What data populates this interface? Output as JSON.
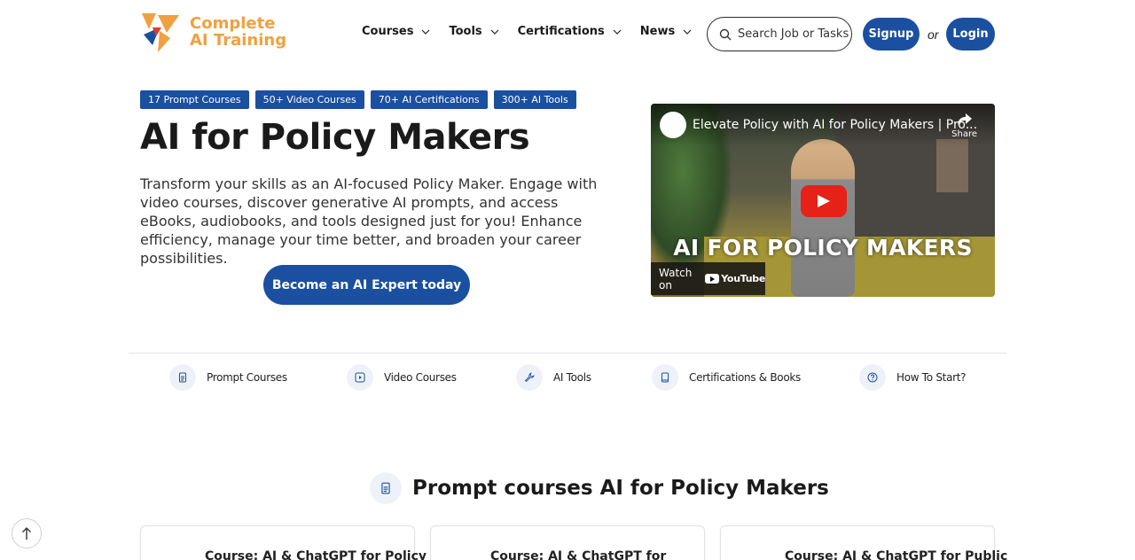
{
  "brand": {
    "line1": "Complete",
    "line2": "AI Training",
    "accent": "#f0a040"
  },
  "nav": [
    {
      "label": "Courses"
    },
    {
      "label": "Tools"
    },
    {
      "label": "Certifications"
    },
    {
      "label": "News"
    }
  ],
  "search": {
    "placeholder": "Search Job or Tasks"
  },
  "auth": {
    "signup": "Signup",
    "or": "or",
    "login": "Login"
  },
  "badges": [
    "17 Prompt Courses",
    "50+ Video Courses",
    "70+ AI Certifications",
    "300+ AI Tools"
  ],
  "hero": {
    "title": "AI for Policy Makers",
    "description": "Transform your skills as an AI-focused Policy Maker. Engage with video courses, discover generative AI prompts, and access eBooks, audiobooks, and tools designed just for you! Enhance efficiency, manage your time better, and broaden your career possibilities.",
    "cta": "Become an AI Expert today"
  },
  "video": {
    "title": "Elevate Policy with AI for Policy Makers | Pro...",
    "share": "Share",
    "caption": "AI FOR POLICY MAKERS",
    "watch_on": "Watch on",
    "youtube": "YouTube"
  },
  "tabs": [
    {
      "label": "Prompt Courses",
      "icon": "document-icon"
    },
    {
      "label": "Video Courses",
      "icon": "play-icon"
    },
    {
      "label": "AI Tools",
      "icon": "wrench-icon"
    },
    {
      "label": "Certifications & Books",
      "icon": "book-icon"
    },
    {
      "label": "How To Start?",
      "icon": "question-icon"
    }
  ],
  "section": {
    "title": "Prompt courses AI for Policy Makers"
  },
  "cards": [
    {
      "title": "Course: AI & ChatGPT for Policy"
    },
    {
      "title": "Course: AI & ChatGPT for"
    },
    {
      "title": "Course: AI & ChatGPT for Public"
    }
  ],
  "colors": {
    "primary": "#1b4fa0",
    "tab_icon_bg": "#eef2f8"
  }
}
